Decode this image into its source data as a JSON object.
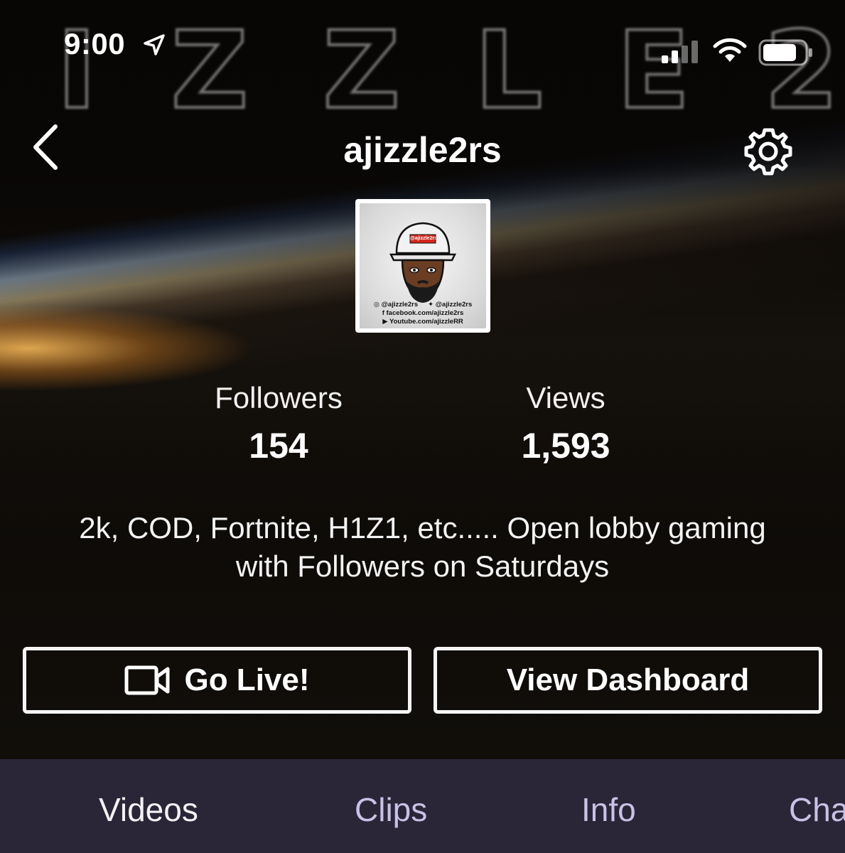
{
  "status_bar": {
    "time": "9:00",
    "icons": [
      "location-arrow-icon",
      "cellular-signal-icon",
      "wifi-icon",
      "battery-icon"
    ]
  },
  "banner": {
    "watermark_letters": [
      "I",
      "Z",
      "Z",
      "L",
      "E",
      "2"
    ]
  },
  "nav": {
    "back_icon": "chevron-left-icon",
    "title": "ajizzle2rs",
    "settings_icon": "gear-icon"
  },
  "avatar": {
    "hat_label": "@ajizzle2rs",
    "socials": {
      "instagram": "@ajizzle2rs",
      "twitter": "@ajizzle2rs",
      "facebook": "facebook.com/ajizzle2rs",
      "youtube": "Youtube.com/ajizzleRR"
    }
  },
  "stats": {
    "followers_label": "Followers",
    "followers_value": "154",
    "views_label": "Views",
    "views_value": "1,593"
  },
  "bio": {
    "line1": "2k, COD, Fortnite, H1Z1, etc..... Open lobby gaming",
    "line2": "with Followers on Saturdays"
  },
  "actions": {
    "go_live_label": "Go Live!",
    "go_live_icon": "video-camera-icon",
    "dashboard_label": "View Dashboard"
  },
  "tabs": [
    {
      "label": "Videos",
      "active": true
    },
    {
      "label": "Clips",
      "active": false
    },
    {
      "label": "Info",
      "active": false
    },
    {
      "label": "Cha",
      "active": false
    }
  ],
  "colors": {
    "tabbar_bg": "#2b2538",
    "tab_inactive": "#c9c2e6",
    "tab_active": "#f2f2f2",
    "button_border": "#f5f5f5"
  }
}
